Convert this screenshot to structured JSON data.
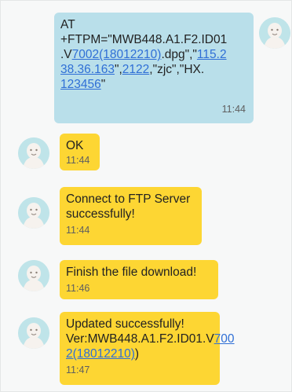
{
  "colors": {
    "sent_bubble": "#b9dfea",
    "received_bubble": "#fdd633",
    "link": "#2f6fd6",
    "avatar": "#bfe4e9",
    "background": "#f7f8f8"
  },
  "messages": [
    {
      "direction": "sent",
      "lines": [
        {
          "parts": [
            {
              "text": "AT"
            }
          ]
        },
        {
          "parts": [
            {
              "text": "+FTPM=\"MWB448.A1.F2.ID01"
            }
          ]
        },
        {
          "parts": [
            {
              "text": ".V"
            },
            {
              "text": "7002(18012210)",
              "link": true
            },
            {
              "text": ".dpg\",\""
            },
            {
              "text": "115.2",
              "link": true
            }
          ]
        },
        {
          "parts": [
            {
              "text": "38.36.163",
              "link": true
            },
            {
              "text": "\","
            },
            {
              "text": "2122",
              "link": true
            },
            {
              "text": ",\"zjc\",\"HX."
            }
          ]
        },
        {
          "parts": [
            {
              "text": "123456",
              "link": true
            },
            {
              "text": "\""
            }
          ]
        }
      ],
      "time": "11:44"
    },
    {
      "direction": "received",
      "lines": [
        {
          "parts": [
            {
              "text": "OK"
            }
          ]
        }
      ],
      "time": "11:44"
    },
    {
      "direction": "received",
      "lines": [
        {
          "parts": [
            {
              "text": "Connect to FTP Server"
            }
          ]
        },
        {
          "parts": [
            {
              "text": "successfully!"
            }
          ]
        }
      ],
      "time": "11:44"
    },
    {
      "direction": "received",
      "lines": [
        {
          "parts": [
            {
              "text": "Finish the file download!"
            }
          ]
        }
      ],
      "time": "11:46"
    },
    {
      "direction": "received",
      "lines": [
        {
          "parts": [
            {
              "text": "Updated successfully!"
            }
          ]
        },
        {
          "parts": [
            {
              "text": "Ver:MWB448.A1.F2.ID01.V"
            },
            {
              "text": "700",
              "link": true
            }
          ]
        },
        {
          "parts": [
            {
              "text": "2(18012210)",
              "link": true
            },
            {
              "text": ")"
            }
          ]
        }
      ],
      "time": "11:47"
    }
  ]
}
